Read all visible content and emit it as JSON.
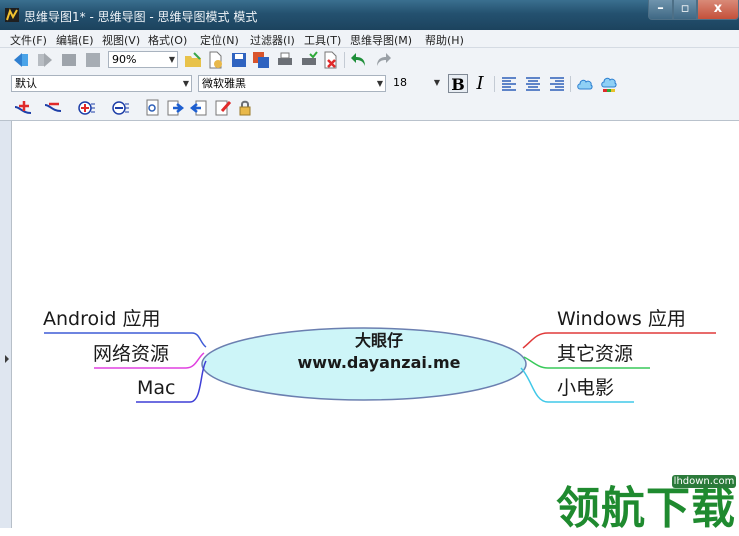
{
  "window": {
    "title": "思维导图1* - 思维导图 - 思维导图模式 模式",
    "controls": {
      "minimize": "–",
      "maximize": "▫",
      "close": "x"
    }
  },
  "menu": [
    "文件(F)",
    "编辑(E)",
    "视图(V)",
    "格式(O)",
    "定位(N)",
    "过滤器(I)",
    "工具(T)",
    "思维导图(M)",
    "帮助(H)"
  ],
  "toolbar": {
    "zoom": "90%",
    "style": "默认",
    "font": "微软雅黑",
    "font_size": "18",
    "bold": "B",
    "italic": "I"
  },
  "mindmap": {
    "central": {
      "line1": "大眼仔",
      "line2": "www.dayanzai.me"
    },
    "left": [
      "Android 应用",
      "网络资源",
      "Mac"
    ],
    "right": [
      "Windows 应用",
      "其它资源",
      "小电影"
    ],
    "branch_colors": {
      "android": "#3f5bd6",
      "web": "#e040e0",
      "mac": "#3f3fd6",
      "windows": "#e03a3a",
      "other": "#39c95a",
      "movie": "#40c8e8"
    }
  },
  "watermark": {
    "text": "领航下载",
    "url": "lhdown.com"
  }
}
